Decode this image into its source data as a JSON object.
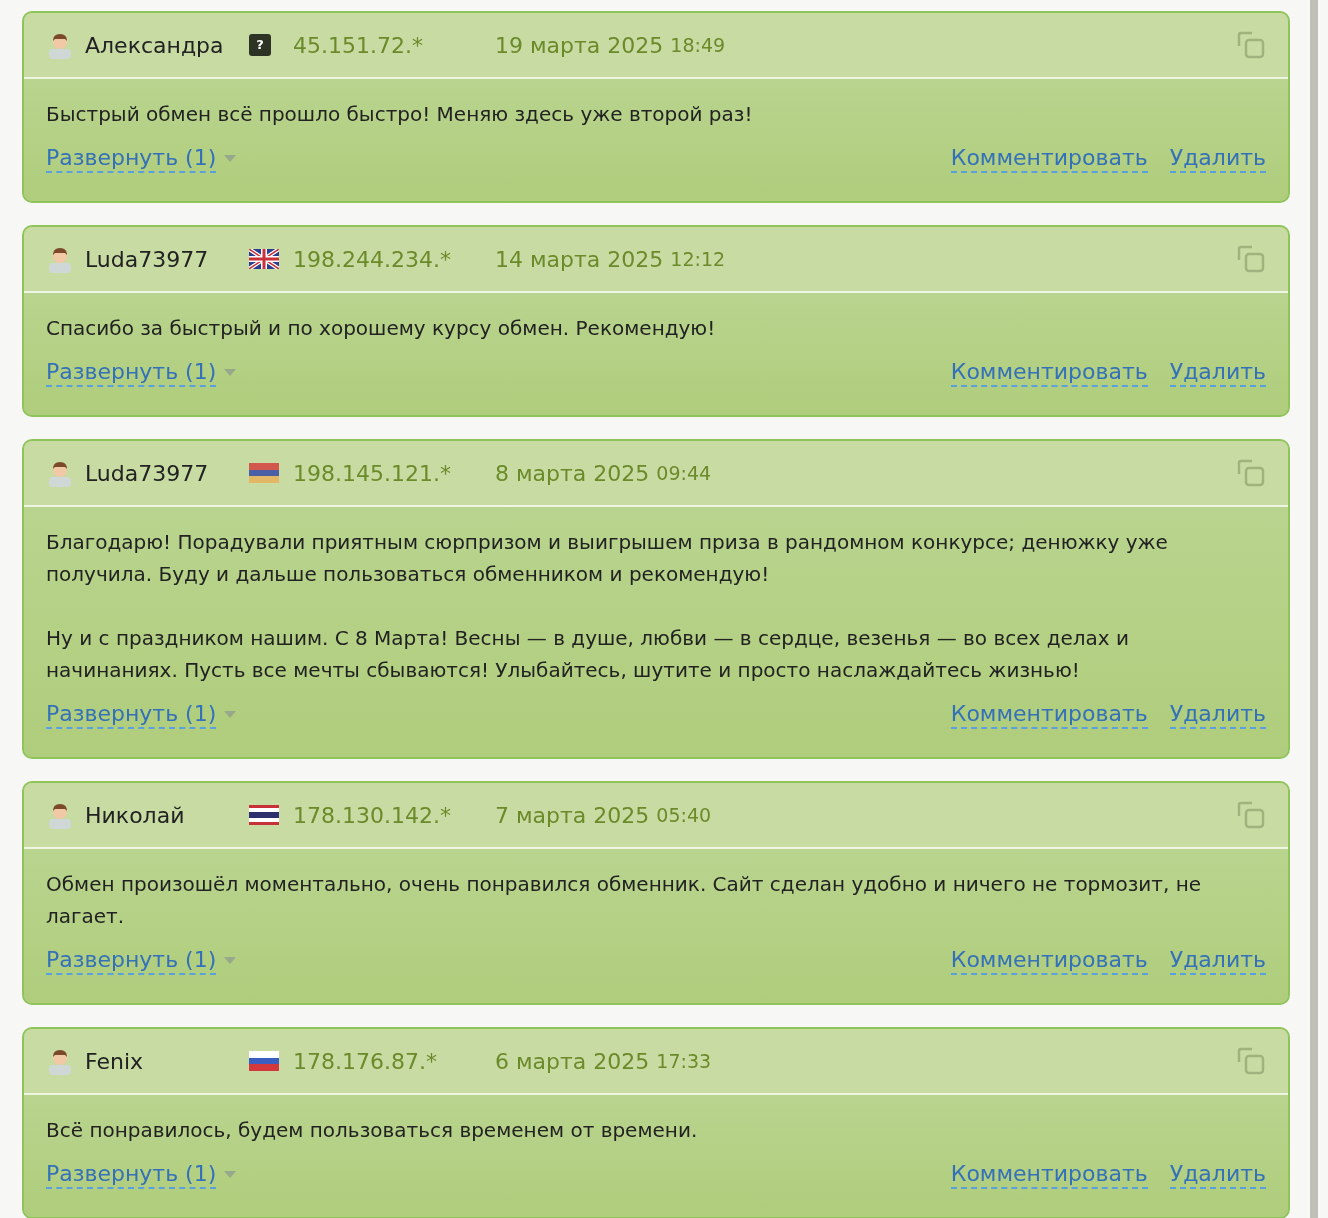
{
  "reviews": [
    {
      "author": "Александра",
      "flag": {
        "kind": "unknown",
        "text": "?"
      },
      "ip": "45.151.72.*",
      "date": "19 марта 2025",
      "time": "18:49",
      "paragraphs": [
        "Быстрый обмен всё прошло быстро! Меняю здесь уже второй раз!"
      ],
      "expand": "Развернуть (1)",
      "actions": [
        "Комментировать",
        "Удалить"
      ]
    },
    {
      "author": "Luda73977",
      "flag": {
        "kind": "gb"
      },
      "ip": "198.244.234.*",
      "date": "14 марта 2025",
      "time": "12:12",
      "paragraphs": [
        "Спасибо за быстрый и по хорошему курсу обмен. Рекомендую!"
      ],
      "expand": "Развернуть (1)",
      "actions": [
        "Комментировать",
        "Удалить"
      ]
    },
    {
      "author": "Luda73977",
      "flag": {
        "kind": "am"
      },
      "ip": "198.145.121.*",
      "date": "8 марта 2025",
      "time": "09:44",
      "paragraphs": [
        "Благодарю! Порадували приятным сюрпризом и выигрышем приза в рандомном конкурсе; денюжку уже получила. Буду и дальше пользоваться обменником и рекомендую!",
        "Ну и с праздником нашим. С 8 Марта! Весны — в душе, любви — в сердце, везенья — во всех делах и начинаниях. Пусть все мечты сбываются! Улыбайтесь, шутите и просто наслаждайтесь жизнью!"
      ],
      "expand": "Развернуть (1)",
      "actions": [
        "Комментировать",
        "Удалить"
      ]
    },
    {
      "author": "Николай",
      "flag": {
        "kind": "th"
      },
      "ip": "178.130.142.*",
      "date": "7 марта 2025",
      "time": "05:40",
      "paragraphs": [
        "Обмен произошёл моментально, очень понравился обменник. Сайт сделан удобно и ничего не тормозит, не лагает."
      ],
      "expand": "Развернуть (1)",
      "actions": [
        "Комментировать",
        "Удалить"
      ]
    },
    {
      "author": "Fenix",
      "flag": {
        "kind": "ru"
      },
      "ip": "178.176.87.*",
      "date": "6 марта 2025",
      "time": "17:33",
      "paragraphs": [
        "Всё понравилось, будем пользоваться временем от времени."
      ],
      "expand": "Развернуть (1)",
      "actions": [
        "Комментировать",
        "Удалить"
      ]
    }
  ]
}
